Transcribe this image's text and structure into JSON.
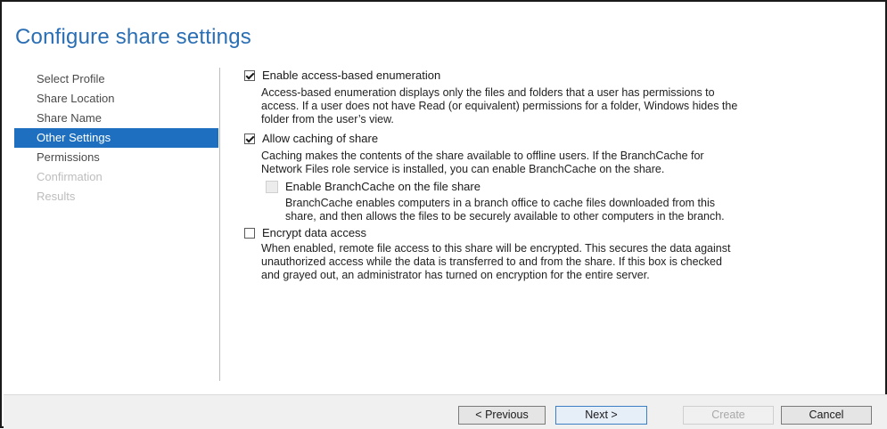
{
  "window": {
    "title": "Configure share settings"
  },
  "nav": {
    "items": [
      {
        "label": "Select Profile",
        "state": "normal"
      },
      {
        "label": "Share Location",
        "state": "normal"
      },
      {
        "label": "Share Name",
        "state": "normal"
      },
      {
        "label": "Other Settings",
        "state": "active"
      },
      {
        "label": "Permissions",
        "state": "normal"
      },
      {
        "label": "Confirmation",
        "state": "disabled"
      },
      {
        "label": "Results",
        "state": "disabled"
      }
    ]
  },
  "options": {
    "abe": {
      "label": "Enable access-based enumeration",
      "checked": true,
      "desc_lines": [
        "Access-based enumeration displays only the files and folders that a user has permissions to",
        "access. If a user does not have Read (or equivalent) permissions for a folder, Windows hides the",
        "folder from the user’s view."
      ]
    },
    "caching": {
      "label": "Allow caching of share",
      "checked": true,
      "desc_lines": [
        "Caching makes the contents of the share available to offline users. If the BranchCache for",
        "Network Files role service is installed, you can enable BranchCache on the share."
      ]
    },
    "branchcache": {
      "label": "Enable BranchCache on the file share",
      "checked": false,
      "disabled": true,
      "desc_lines": [
        "BranchCache enables computers in a branch office to cache files downloaded from this",
        "share, and then allows the files to be securely available to other computers in the branch."
      ]
    },
    "encrypt": {
      "label": "Encrypt data access",
      "checked": false,
      "desc_lines": [
        "When enabled, remote file access to this share will be encrypted. This secures the data against",
        "unauthorized access while the data is transferred to and from the share. If this box is checked",
        "and grayed out, an administrator has turned on encryption for the entire server."
      ]
    }
  },
  "buttons": {
    "previous": "< Previous",
    "next": "Next >",
    "create": "Create",
    "cancel": "Cancel"
  },
  "colors": {
    "title": "#2a6eb4",
    "nav_active_bg": "#1e6fbf"
  }
}
